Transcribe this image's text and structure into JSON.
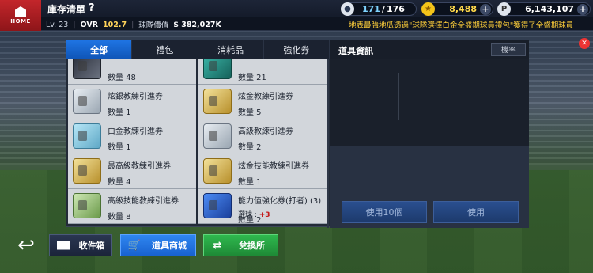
{
  "header": {
    "home_label": "HOME",
    "title": "庫存清單",
    "help": "?",
    "energy": {
      "current": "171",
      "sep": "/",
      "max": "176"
    },
    "gold": "8,488",
    "points": "6,143,107",
    "plus": "+"
  },
  "subinfo": {
    "lv_label": "Lv. 23",
    "ovr_label": "OVR",
    "ovr_value": "102.7",
    "team_value_label": "球隊價值",
    "team_value": "$ 382,027K"
  },
  "ticker": "地表最強地瓜透過\"球隊選擇白金全盛期球員禮包\"獲得了全盛期球員",
  "tabs": [
    {
      "label": "全部",
      "active": true
    },
    {
      "label": "禮包"
    },
    {
      "label": "消耗品"
    },
    {
      "label": "強化券"
    }
  ],
  "info_panel": {
    "title": "道具資訊",
    "rate_button": "機率",
    "use10_button": "使用10個",
    "use_button": "使用"
  },
  "items_left": [
    {
      "name": "",
      "qty": "數量 48",
      "icon": "dark-ball-icon"
    },
    {
      "name": "炫銀教練引進券",
      "qty": "數量 1",
      "icon": "silver-card-icon"
    },
    {
      "name": "白金教練引進券",
      "qty": "數量 1",
      "icon": "platinum-card-icon"
    },
    {
      "name": "最高級教練引進券",
      "qty": "數量 4",
      "icon": "gold-card-icon"
    },
    {
      "name": "高級技能教練引進券",
      "qty": "數量 8",
      "icon": "silver-card-icon"
    }
  ],
  "items_right": [
    {
      "name": "",
      "qty": "數量 21",
      "icon": "skin-ticket-icon"
    },
    {
      "name": "炫金教練引進券",
      "qty": "數量 5",
      "icon": "gold-card-icon"
    },
    {
      "name": "高級教練引進券",
      "qty": "數量 2",
      "icon": "silver-card-icon"
    },
    {
      "name": "炫金技能教練引進券",
      "qty": "數量 1",
      "icon": "gold-card-icon"
    },
    {
      "name": "能力值強化券(打者) (3)",
      "extra_label": "選球 : ",
      "extra_value": "+3",
      "qty": "數量 2",
      "icon": "batter-boost-icon"
    }
  ],
  "bottom": {
    "mailbox": "收件箱",
    "shop": "道具商城",
    "exchange": "兌換所"
  },
  "colors": {
    "accent_blue": "#1f74e3",
    "home_red": "#c3262b",
    "gold": "#ffd94a",
    "ticker": "#ffcf3a"
  }
}
